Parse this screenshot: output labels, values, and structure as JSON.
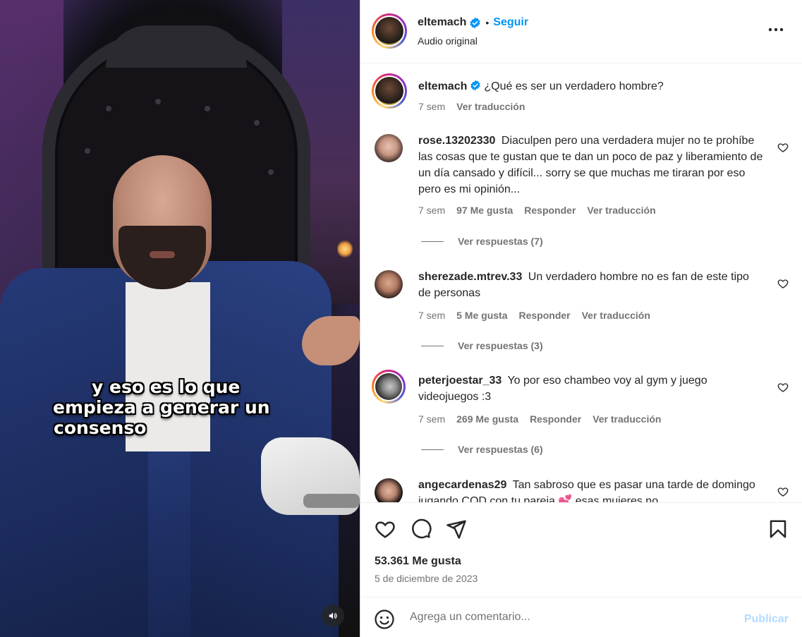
{
  "video": {
    "caption_lines": [
      "y eso es lo que",
      "empieza a generar un",
      "consenso"
    ],
    "mute_icon": "speaker-icon"
  },
  "header": {
    "username": "eltemach",
    "verified": true,
    "separator": "•",
    "follow_label": "Seguir",
    "subtitle": "Audio original",
    "more_icon": "more-horizontal-icon"
  },
  "caption_post": {
    "username": "eltemach",
    "text": "¿Qué es ser un verdadero hombre?",
    "time": "7 sem",
    "translate": "Ver traducción"
  },
  "comments": [
    {
      "username": "rose.13202330",
      "text": "Diaculpen pero una verdadera mujer no te prohíbe las cosas que te gustan que te dan un poco de paz y liberamiento de un día cansado y difícil... sorry se que muchas me tiraran por eso pero es mi opinión...",
      "time": "7 sem",
      "likes": "97 Me gusta",
      "reply": "Responder",
      "translate": "Ver traducción",
      "replies": "Ver respuestas (7)"
    },
    {
      "username": "sherezade.mtrev.33",
      "text": "Un verdadero hombre no es fan de este tipo de personas",
      "time": "7 sem",
      "likes": "5 Me gusta",
      "reply": "Responder",
      "translate": "Ver traducción",
      "replies": "Ver respuestas (3)"
    },
    {
      "username": "peterjoestar_33",
      "text": "Yo por eso chambeo voy al gym y juego videojuegos :3",
      "time": "7 sem",
      "likes": "269 Me gusta",
      "reply": "Responder",
      "translate": "Ver traducción",
      "replies": "Ver respuestas (6)"
    },
    {
      "username": "angecardenas29",
      "text": "Tan sabroso que es pasar una tarde de domingo jugando COD con tu pareja 💕 esas mujeres no"
    }
  ],
  "actions": {
    "like_icon": "heart-icon",
    "comment_icon": "comment-icon",
    "share_icon": "send-icon",
    "save_icon": "bookmark-icon",
    "likes_count": "53.361 Me gusta",
    "date": "5 de diciembre de 2023"
  },
  "composer": {
    "placeholder": "Agrega un comentario...",
    "publish_label": "Publicar",
    "emoji_icon": "emoji-icon"
  },
  "colors": {
    "accent": "#0095f6",
    "muted": "#737373",
    "text": "#262626",
    "publish_disabled": "#b3dbff"
  }
}
